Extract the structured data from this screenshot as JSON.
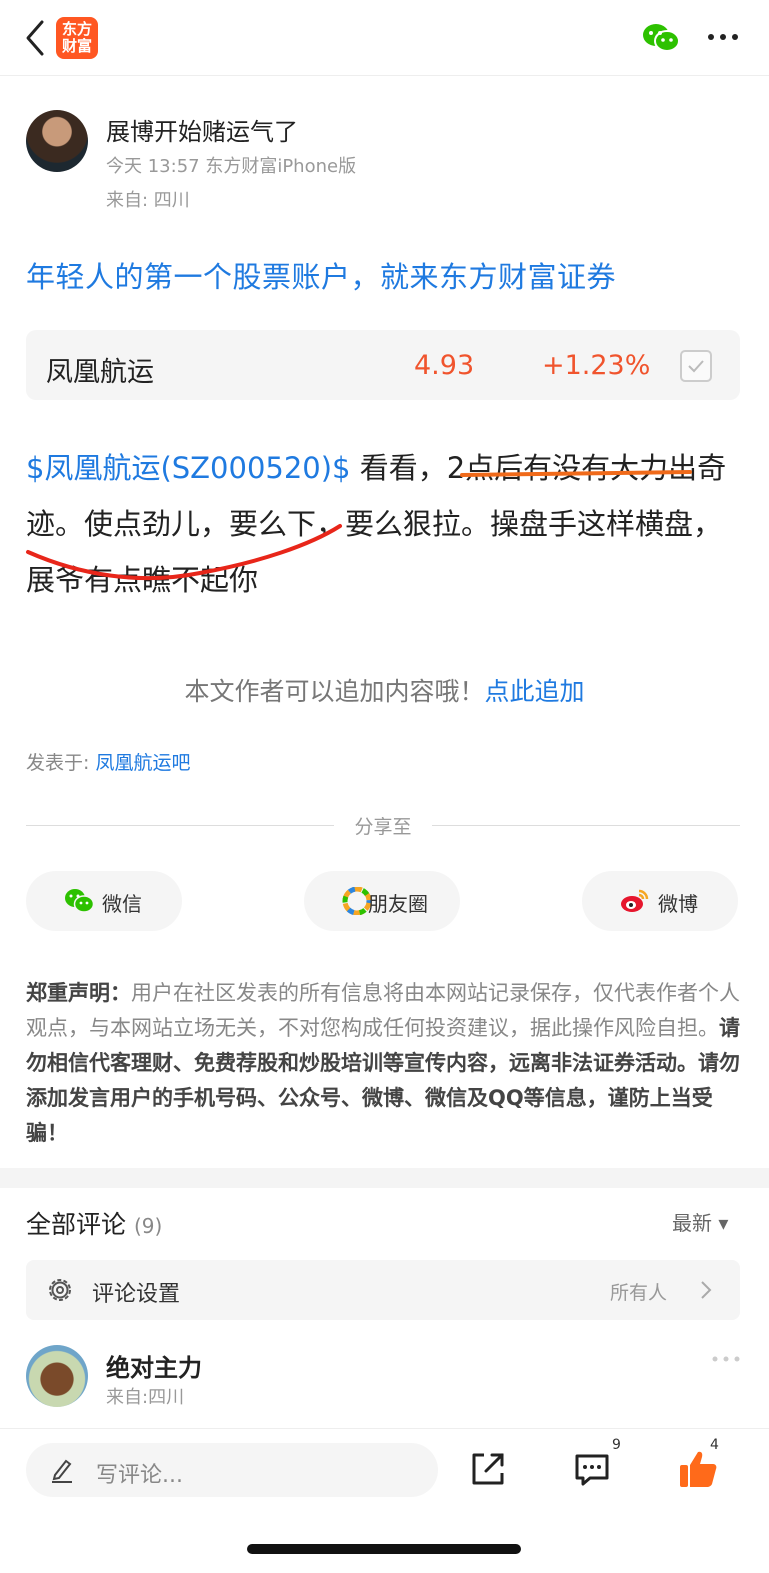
{
  "header": {
    "back_icon": "chevron-left-icon",
    "logo_text": "东方财富",
    "logo_color": "#ff5722",
    "wechat_icon": "wechat-icon",
    "more_icon": "more-dots-icon"
  },
  "author": {
    "name": "展博开始赌运气了",
    "meta": "今天 13:57 东方财富iPhone版",
    "location": "来自: 四川"
  },
  "promo_text": "年轻人的第一个股票账户，就来东方财富证券",
  "stock": {
    "name": "凤凰航运",
    "price": "4.93",
    "change": "+1.23%",
    "color_up": "#f0542d"
  },
  "post": {
    "tag": "$凤凰航运(SZ000520)$",
    "text": " 看看，2点后有没有大力出奇迹。使点劲儿，要么下，要么狠拉。操盘手这样横盘，展爷有点瞧不起你"
  },
  "append": {
    "text": "本文作者可以追加内容哦！",
    "link": "点此追加"
  },
  "posted_in": {
    "label": "发表于: ",
    "link": "凤凰航运吧"
  },
  "share": {
    "label": "分享至",
    "buttons": [
      {
        "label": "微信",
        "icon": "wechat-icon"
      },
      {
        "label": "朋友圈",
        "icon": "moments-icon"
      },
      {
        "label": "微博",
        "icon": "weibo-icon"
      }
    ]
  },
  "disclaimer": {
    "title": "郑重声明：",
    "body": "用户在社区发表的所有信息将由本网站记录保存，仅代表作者个人观点，与本网站立场无关，不对您构成任何投资建议，据此操作风险自担。",
    "warning": "请勿相信代客理财、免费荐股和炒股培训等宣传内容，远离非法证券活动。请勿添加发言用户的手机号码、公众号、微博、微信及QQ等信息，谨防上当受骗！"
  },
  "comments": {
    "title": "全部评论",
    "count": "(9)",
    "sort": "最新 ▾",
    "settings_label": "评论设置",
    "settings_value": "所有人",
    "items": [
      {
        "name": "绝对主力",
        "location": "来自:四川"
      }
    ]
  },
  "bottom": {
    "input_placeholder": "写评论...",
    "comment_count": "9",
    "like_count": "4",
    "like_color": "#ff6a1a"
  }
}
